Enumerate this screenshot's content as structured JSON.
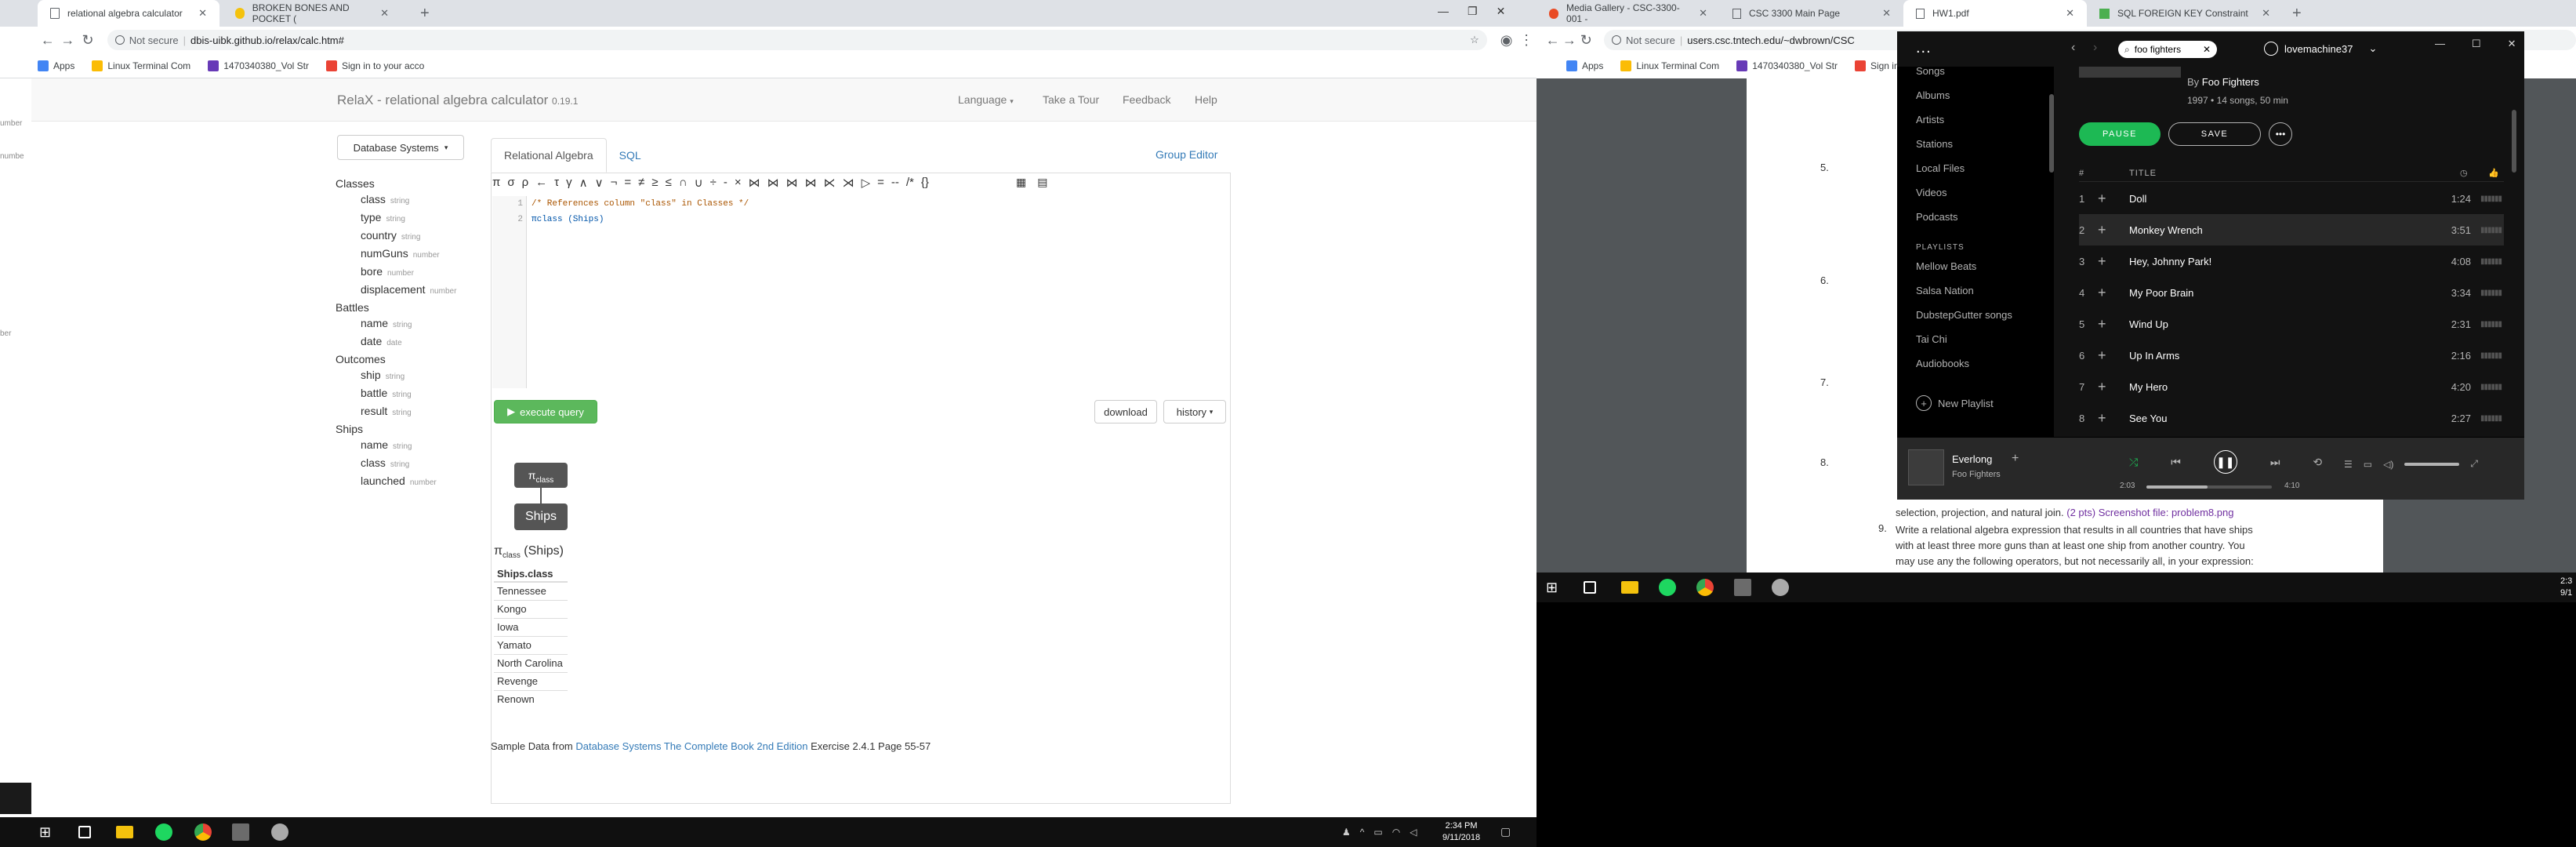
{
  "left_browser": {
    "tabs": [
      {
        "title": "relational algebra calculator"
      },
      {
        "title": "BROKEN BONES AND POCKET ("
      }
    ],
    "not_secure": "Not secure",
    "url": "dbis-uibk.github.io/relax/calc.htm#",
    "bookmarks": [
      "Apps",
      "Linux Terminal Com",
      "1470340380_Vol Str",
      "Sign in to your acco"
    ]
  },
  "relax": {
    "brand": "RelaX - relational algebra calculator",
    "version": "0.19.1",
    "nav": [
      "Language",
      "Take a Tour",
      "Feedback",
      "Help"
    ],
    "db_select": "Database Systems",
    "tabs": [
      "Relational Algebra",
      "SQL"
    ],
    "group_editor": "Group Editor",
    "toolbar_ops": [
      "π",
      "σ",
      "ρ",
      "←",
      "τ",
      "γ",
      "∧",
      "∨",
      "¬",
      "=",
      "≠",
      "≥",
      "≤",
      "∩",
      "∪",
      "÷",
      "-",
      "×",
      "⋈",
      "⋈",
      "⋈",
      "⋈",
      "⋉",
      "⋊",
      "▷",
      "=",
      "--",
      "/*",
      "{}"
    ],
    "schema": [
      {
        "name": "Classes",
        "fields": [
          [
            "class",
            "string"
          ],
          [
            "type",
            "string"
          ],
          [
            "country",
            "string"
          ],
          [
            "numGuns",
            "number"
          ],
          [
            "bore",
            "number"
          ],
          [
            "displacement",
            "number"
          ]
        ]
      },
      {
        "name": "Battles",
        "fields": [
          [
            "name",
            "string"
          ],
          [
            "date",
            "date"
          ]
        ]
      },
      {
        "name": "Outcomes",
        "fields": [
          [
            "ship",
            "string"
          ],
          [
            "battle",
            "string"
          ],
          [
            "result",
            "string"
          ]
        ]
      },
      {
        "name": "Ships",
        "fields": [
          [
            "name",
            "string"
          ],
          [
            "class",
            "string"
          ],
          [
            "launched",
            "number"
          ]
        ]
      }
    ],
    "code_lines": [
      "/* References column \"class\" in Classes */",
      "πclass (Ships)"
    ],
    "line_numbers": [
      "1",
      "2"
    ],
    "execute": "execute query",
    "download": "download",
    "history": "history",
    "tree_pi": "π",
    "tree_sub": "class",
    "tree_leaf": "Ships",
    "result_expr_pi": "π",
    "result_expr_sub": "class",
    "result_expr_rel": "(Ships)",
    "result_header": "Ships.class",
    "result_rows": [
      "Tennessee",
      "Kongo",
      "Iowa",
      "Yamato",
      "North Carolina",
      "Revenge",
      "Renown"
    ],
    "sample_prefix": "Sample Data from",
    "sample_link": "Database Systems The Complete Book 2nd Edition",
    "sample_suffix": "Exercise 2.4.1 Page 55-57"
  },
  "left_fragments": [
    "acco",
    "umber",
    "numbe",
    "ber"
  ],
  "left_taskbar": {
    "time": "2:34 PM",
    "date": "9/11/2018"
  },
  "right_browser": {
    "tabs": [
      "Media Gallery - CSC-3300-001 -",
      "CSC 3300 Main Page",
      "HW1.pdf",
      "SQL FOREIGN KEY Constraint"
    ],
    "not_secure": "Not secure",
    "url": "users.csc.tntech.edu/~dwbrown/CSC",
    "bookmarks": [
      "Apps",
      "Linux Terminal Com",
      "1470340380_Vol Str",
      "Sign in to your acco"
    ]
  },
  "pdf": {
    "numbers": [
      "5.",
      "6.",
      "7.",
      "8.",
      "9."
    ],
    "line8_tail": "selection, projection, and natural join.",
    "line8_pts": "(2 pts)",
    "line8_file": "Screenshot file: problem8.png",
    "q9_a": "Write a relational algebra expression that results in all countries that have ships",
    "q9_b": "with at least three more guns than at least one ship from another country. You",
    "q9_c": "may use any the following operators, but not necessarily all, in your expression:"
  },
  "spotify": {
    "search": "foo fighters",
    "user": "lovemachine37",
    "menu": "...",
    "library": [
      "Songs",
      "Albums",
      "Artists",
      "Stations",
      "Local Files",
      "Videos",
      "Podcasts"
    ],
    "playlists_label": "PLAYLISTS",
    "playlists": [
      "Mellow Beats",
      "Salsa Nation",
      "DubstepGutter songs",
      "Tai Chi",
      "Audiobooks"
    ],
    "new_playlist": "New Playlist",
    "by": "By",
    "artist": "Foo Fighters",
    "meta": "1997 • 14 songs, 50 min",
    "pause": "PAUSE",
    "save": "SAVE",
    "col_num": "#",
    "col_title": "TITLE",
    "tracks": [
      {
        "n": "1",
        "title": "Doll",
        "dur": "1:24"
      },
      {
        "n": "2",
        "title": "Monkey Wrench",
        "dur": "3:51"
      },
      {
        "n": "3",
        "title": "Hey, Johnny Park!",
        "dur": "4:08"
      },
      {
        "n": "4",
        "title": "My Poor Brain",
        "dur": "3:34"
      },
      {
        "n": "5",
        "title": "Wind Up",
        "dur": "2:31"
      },
      {
        "n": "6",
        "title": "Up In Arms",
        "dur": "2:16"
      },
      {
        "n": "7",
        "title": "My Hero",
        "dur": "4:20"
      },
      {
        "n": "8",
        "title": "See You",
        "dur": "2:27"
      }
    ],
    "now_playing": "Everlong",
    "now_artist": "Foo Fighters",
    "elapsed": "2:03",
    "total": "4:10",
    "progress": 0.49
  },
  "right_taskbar": {
    "time": "2:3",
    "date": "9/1"
  }
}
